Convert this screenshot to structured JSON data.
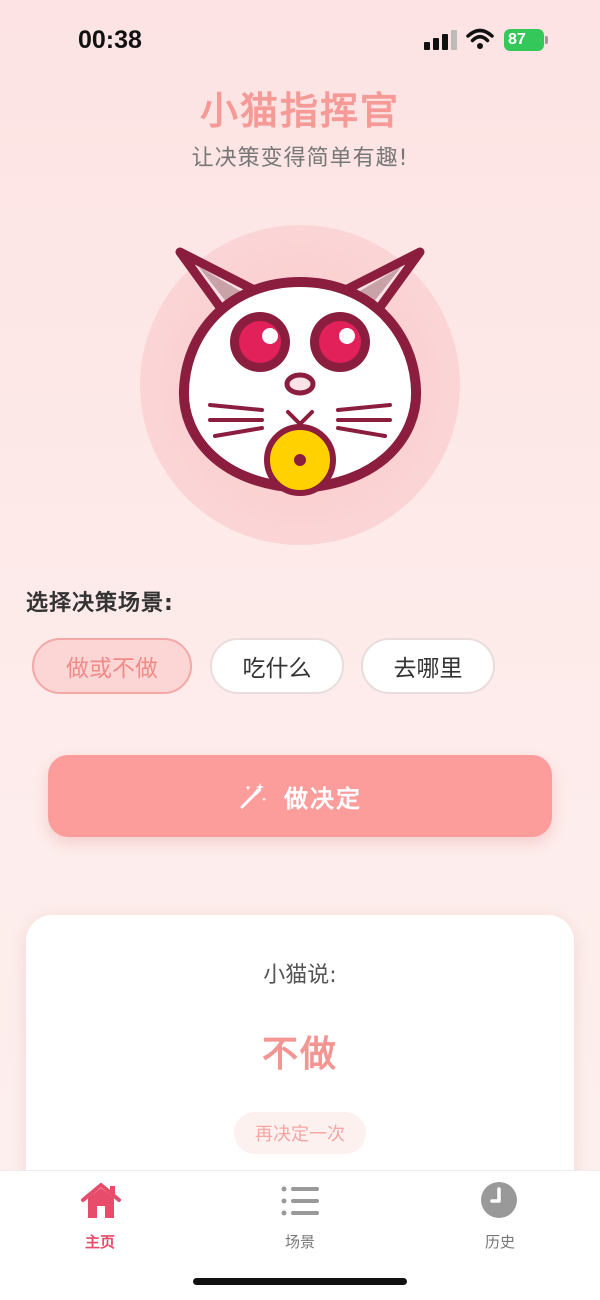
{
  "status": {
    "time": "00:38",
    "battery": "87"
  },
  "header": {
    "title": "小猫指挥官",
    "subtitle": "让决策变得简单有趣!"
  },
  "scene": {
    "label": "选择决策场景:",
    "options": [
      {
        "label": "做或不做",
        "selected": true
      },
      {
        "label": "吃什么",
        "selected": false
      },
      {
        "label": "去哪里",
        "selected": false
      }
    ]
  },
  "decide": {
    "label": "做决定",
    "icon": "magic-wand-icon"
  },
  "result": {
    "label": "小猫说:",
    "value": "不做",
    "again_label": "再决定一次"
  },
  "tabs": [
    {
      "label": "主页",
      "icon": "home-icon",
      "active": true
    },
    {
      "label": "场景",
      "icon": "list-icon",
      "active": false
    },
    {
      "label": "历史",
      "icon": "clock-icon",
      "active": false
    }
  ],
  "colors": {
    "accent": "#f59a96",
    "button": "#fc9d9c",
    "tab_active": "#e74c6a",
    "cat_outline": "#8b1e3f",
    "coin": "#ffd100"
  }
}
